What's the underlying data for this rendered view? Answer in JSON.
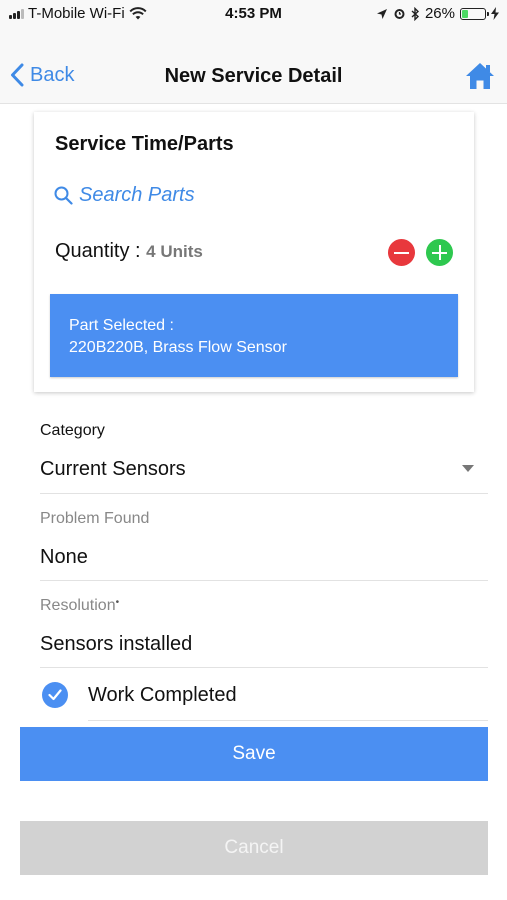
{
  "status_bar": {
    "carrier": "T-Mobile Wi-Fi",
    "time": "4:53 PM",
    "battery": "26%",
    "battery_level": 0.26,
    "icons": [
      "signal-icon",
      "wifi-icon",
      "location-icon",
      "alarm-icon",
      "bluetooth-icon",
      "battery-icon",
      "charging-icon"
    ]
  },
  "nav": {
    "back_label": "Back",
    "title": "New Service Detail",
    "home_icon": "home-icon",
    "accent": "#3f8ae6"
  },
  "card": {
    "title": "Service Time/Parts",
    "search_placeholder": "Search Parts",
    "quantity_label": "Quantity : ",
    "quantity_value": "4 Units",
    "part_selected_label": "Part Selected :",
    "part_selected_value": "220B220B, Brass Flow Sensor"
  },
  "form": {
    "category_label": "Category",
    "category_value": "Current Sensors",
    "problem_label": "Problem Found",
    "problem_value": "None",
    "resolution_label": "Resolution",
    "resolution_required": "•",
    "resolution_value": "Sensors installed",
    "work_completed_label": "Work Completed",
    "work_completed_checked": true
  },
  "buttons": {
    "save": "Save",
    "cancel": "Cancel"
  },
  "colors": {
    "primary": "#4b8ff2",
    "minus": "#e8383d",
    "plus": "#2ec84f",
    "disabled": "#d2d2d2"
  }
}
